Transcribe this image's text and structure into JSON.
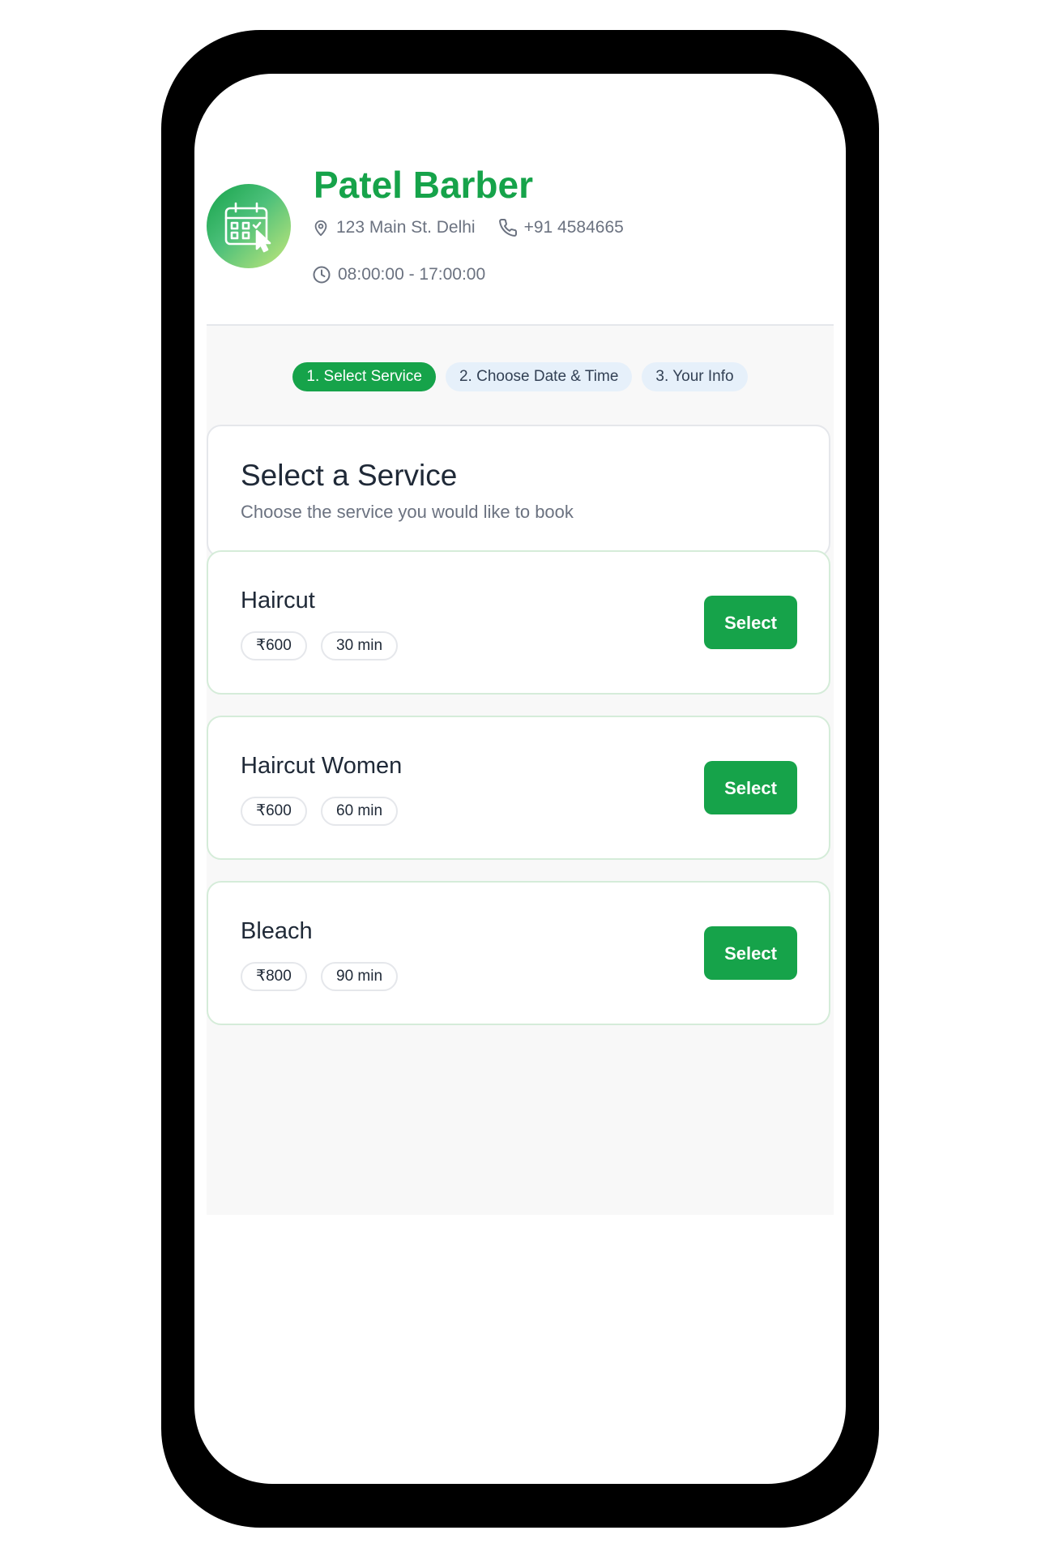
{
  "shop": {
    "name": "Patel Barber",
    "address": "123 Main St. Delhi",
    "phone": "+91 4584665",
    "hours": "08:00:00 - 17:00:00",
    "logo_icon": "calendar-click-icon"
  },
  "steps": [
    {
      "label": "1. Select Service",
      "active": true
    },
    {
      "label": "2. Choose Date & Time",
      "active": false
    },
    {
      "label": "3. Your Info",
      "active": false
    }
  ],
  "intro": {
    "title": "Select a Service",
    "subtitle": "Choose the service you would like to book"
  },
  "services": [
    {
      "name": "Haircut",
      "price": "₹600",
      "duration": "30 min",
      "button": "Select"
    },
    {
      "name": "Haircut Women",
      "price": "₹600",
      "duration": "60 min",
      "button": "Select"
    },
    {
      "name": "Bleach",
      "price": "₹800",
      "duration": "90 min",
      "button": "Select"
    }
  ],
  "colors": {
    "accent": "#16a34a",
    "inactive_step": "#e6f0fa",
    "muted_text": "#6b7280",
    "frame": "#000000"
  }
}
